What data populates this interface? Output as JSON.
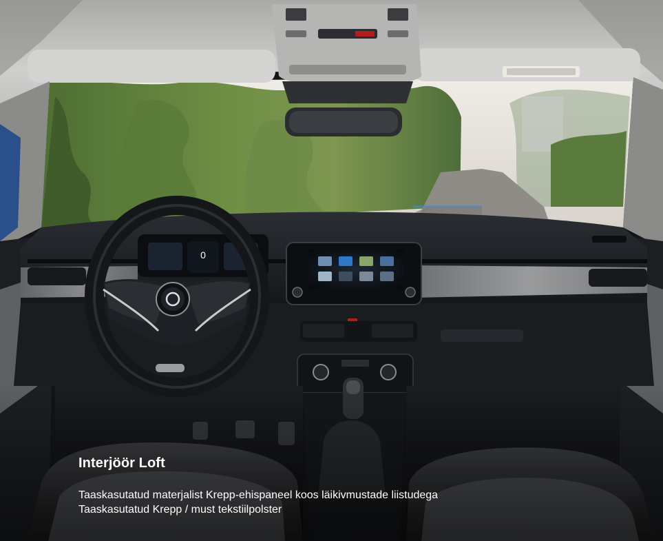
{
  "caption": {
    "title": "Interjöör Loft",
    "lines": [
      "Taaskasutatud materjalist Krepp-ehispaneel koos läikivmustade liistudega",
      "Taaskasutatud Krepp / must tekstiilpolster"
    ]
  },
  "instrument_cluster": {
    "speed_readout": "0"
  },
  "steering_wheel": {
    "brand_logo": "skoda-logo-icon"
  },
  "colors": {
    "headliner": "#c9c9c7",
    "dashboard": "#1b1e22",
    "decor_panel": "#7c7d7f",
    "foliage": "#5f7d3a",
    "sky": "#e6e2dc",
    "screen_accent": "#2f78c8",
    "hazard": "#b21e1e",
    "caption_text": "#ffffff"
  }
}
